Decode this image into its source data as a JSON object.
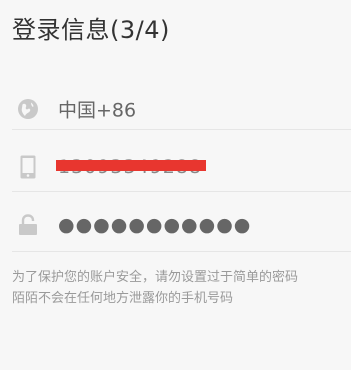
{
  "header": {
    "title": "登录信息(3/4)"
  },
  "form": {
    "country": {
      "icon": "globe-icon",
      "value": "中国+86"
    },
    "phone": {
      "icon": "phone-icon",
      "value": "13093349288",
      "redacted": true,
      "redact_color": "#e8362f"
    },
    "password": {
      "icon": "lock-icon",
      "value": "●●●●●●●●●●●"
    }
  },
  "notice": {
    "line1": "为了保护您的账户安全，请勿设置过于简单的密码",
    "line2": "陌陌不会在任何地方泄露你的手机号码"
  },
  "colors": {
    "background": "#f7f7f7",
    "title_text": "#333333",
    "icon_gray": "#c9c9c9",
    "divider": "#e6e6e6",
    "note_text": "#9a9a9a"
  }
}
